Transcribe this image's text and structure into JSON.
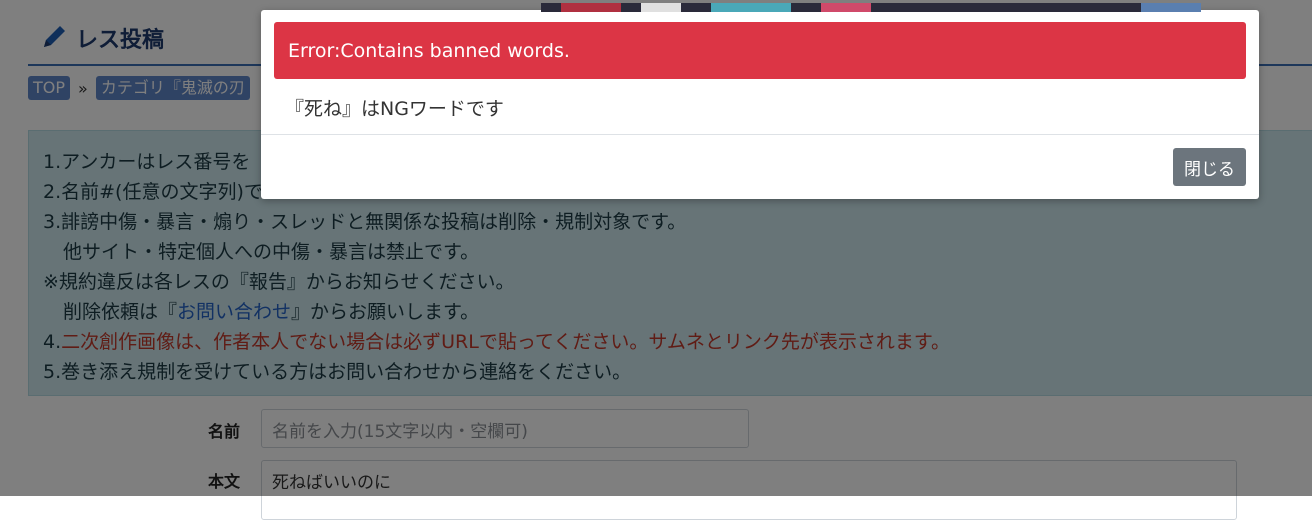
{
  "header": {
    "title": "レス投稿"
  },
  "breadcrumb": {
    "top": "TOP",
    "separator": "»",
    "category": "カテゴリ『鬼滅の刃"
  },
  "rules": {
    "line1": "1.アンカーはレス番号を",
    "line2": "2.名前#(任意の文字列)で",
    "line3": "3.誹謗中傷・暴言・煽り・スレッドと無関係な投稿は削除・規制対象です。",
    "line3b": "他サイト・特定個人への中傷・暴言は禁止です。",
    "line4": "※規約違反は各レスの『報告』からお知らせください。",
    "line5_prefix": "削除依頼は『",
    "line5_link": "お問い合わせ",
    "line5_suffix": "』からお願いします。",
    "line6_prefix": "4.",
    "line6_red": "二次創作画像は、作者本人でない場合は必ずURLで貼ってください。サムネとリンク先が表示されます。",
    "line7": "5.巻き添え規制を受けている方はお問い合わせから連絡をください。"
  },
  "form": {
    "name_label": "名前",
    "name_placeholder": "名前を入力(15文字以内・空欄可)",
    "body_label": "本文",
    "body_value": "死ねばいいのに"
  },
  "modal": {
    "error_title": "Error:Contains banned words.",
    "message": "『死ね』はNGワードです",
    "close_label": "閉じる"
  },
  "colors": {
    "alert": "#dc3545",
    "close_button": "#6c757d",
    "notice_bg": "#cfe9ef",
    "crumb": "#5f86c9"
  }
}
